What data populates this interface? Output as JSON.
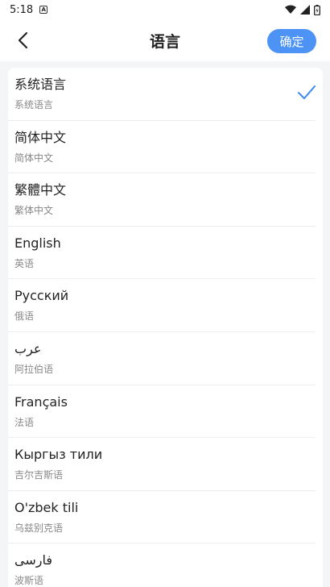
{
  "status_bar": {
    "time": "5:18",
    "notification_icon": "a-notification-icon"
  },
  "header": {
    "title": "语言",
    "confirm_label": "确定",
    "back_icon": "chevron-left-icon"
  },
  "colors": {
    "accent": "#4c93f5",
    "check": "#3c8af0"
  },
  "languages": [
    {
      "name": "系统语言",
      "sub": "系统语言",
      "selected": true
    },
    {
      "name": "简体中文",
      "sub": "简体中文"
    },
    {
      "name": "繁體中文",
      "sub": "繁体中文"
    },
    {
      "name": "English",
      "sub": "英语"
    },
    {
      "name": "Русский",
      "sub": "俄语"
    },
    {
      "name": "عرب",
      "sub": "阿拉伯语"
    },
    {
      "name": "Français",
      "sub": "法语"
    },
    {
      "name": "Кыргыз тили",
      "sub": "吉尔吉斯语"
    },
    {
      "name": "O'zbek tili",
      "sub": "乌兹别克语"
    },
    {
      "name": "فارسی",
      "sub": "波斯语"
    }
  ]
}
